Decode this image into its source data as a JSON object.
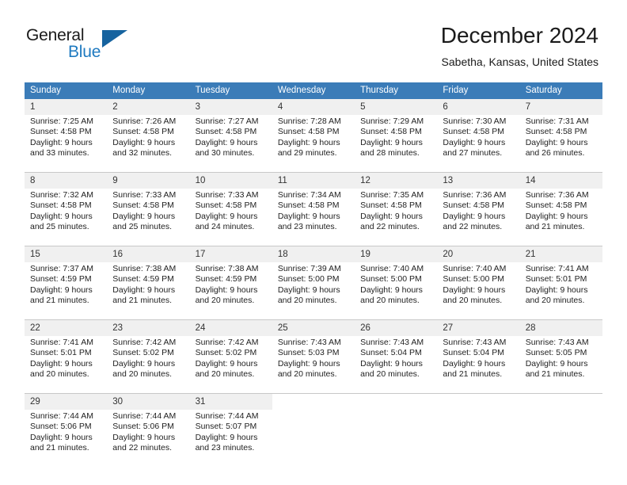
{
  "brand": {
    "name_top": "General",
    "name_bottom": "Blue",
    "triangle_color": "#16639f",
    "blue_color": "#1f7ac0"
  },
  "header": {
    "title": "December 2024",
    "subtitle": "Sabetha, Kansas, United States"
  },
  "theme": {
    "header_bg": "#3b7cb8",
    "daynum_bg": "#f0f0f0",
    "grid_line": "#c8c8c8"
  },
  "weekdays": [
    "Sunday",
    "Monday",
    "Tuesday",
    "Wednesday",
    "Thursday",
    "Friday",
    "Saturday"
  ],
  "weeks": [
    {
      "days": [
        {
          "num": "1",
          "sunrise": "Sunrise: 7:25 AM",
          "sunset": "Sunset: 4:58 PM",
          "daylight1": "Daylight: 9 hours",
          "daylight2": "and 33 minutes."
        },
        {
          "num": "2",
          "sunrise": "Sunrise: 7:26 AM",
          "sunset": "Sunset: 4:58 PM",
          "daylight1": "Daylight: 9 hours",
          "daylight2": "and 32 minutes."
        },
        {
          "num": "3",
          "sunrise": "Sunrise: 7:27 AM",
          "sunset": "Sunset: 4:58 PM",
          "daylight1": "Daylight: 9 hours",
          "daylight2": "and 30 minutes."
        },
        {
          "num": "4",
          "sunrise": "Sunrise: 7:28 AM",
          "sunset": "Sunset: 4:58 PM",
          "daylight1": "Daylight: 9 hours",
          "daylight2": "and 29 minutes."
        },
        {
          "num": "5",
          "sunrise": "Sunrise: 7:29 AM",
          "sunset": "Sunset: 4:58 PM",
          "daylight1": "Daylight: 9 hours",
          "daylight2": "and 28 minutes."
        },
        {
          "num": "6",
          "sunrise": "Sunrise: 7:30 AM",
          "sunset": "Sunset: 4:58 PM",
          "daylight1": "Daylight: 9 hours",
          "daylight2": "and 27 minutes."
        },
        {
          "num": "7",
          "sunrise": "Sunrise: 7:31 AM",
          "sunset": "Sunset: 4:58 PM",
          "daylight1": "Daylight: 9 hours",
          "daylight2": "and 26 minutes."
        }
      ]
    },
    {
      "days": [
        {
          "num": "8",
          "sunrise": "Sunrise: 7:32 AM",
          "sunset": "Sunset: 4:58 PM",
          "daylight1": "Daylight: 9 hours",
          "daylight2": "and 25 minutes."
        },
        {
          "num": "9",
          "sunrise": "Sunrise: 7:33 AM",
          "sunset": "Sunset: 4:58 PM",
          "daylight1": "Daylight: 9 hours",
          "daylight2": "and 25 minutes."
        },
        {
          "num": "10",
          "sunrise": "Sunrise: 7:33 AM",
          "sunset": "Sunset: 4:58 PM",
          "daylight1": "Daylight: 9 hours",
          "daylight2": "and 24 minutes."
        },
        {
          "num": "11",
          "sunrise": "Sunrise: 7:34 AM",
          "sunset": "Sunset: 4:58 PM",
          "daylight1": "Daylight: 9 hours",
          "daylight2": "and 23 minutes."
        },
        {
          "num": "12",
          "sunrise": "Sunrise: 7:35 AM",
          "sunset": "Sunset: 4:58 PM",
          "daylight1": "Daylight: 9 hours",
          "daylight2": "and 22 minutes."
        },
        {
          "num": "13",
          "sunrise": "Sunrise: 7:36 AM",
          "sunset": "Sunset: 4:58 PM",
          "daylight1": "Daylight: 9 hours",
          "daylight2": "and 22 minutes."
        },
        {
          "num": "14",
          "sunrise": "Sunrise: 7:36 AM",
          "sunset": "Sunset: 4:58 PM",
          "daylight1": "Daylight: 9 hours",
          "daylight2": "and 21 minutes."
        }
      ]
    },
    {
      "days": [
        {
          "num": "15",
          "sunrise": "Sunrise: 7:37 AM",
          "sunset": "Sunset: 4:59 PM",
          "daylight1": "Daylight: 9 hours",
          "daylight2": "and 21 minutes."
        },
        {
          "num": "16",
          "sunrise": "Sunrise: 7:38 AM",
          "sunset": "Sunset: 4:59 PM",
          "daylight1": "Daylight: 9 hours",
          "daylight2": "and 21 minutes."
        },
        {
          "num": "17",
          "sunrise": "Sunrise: 7:38 AM",
          "sunset": "Sunset: 4:59 PM",
          "daylight1": "Daylight: 9 hours",
          "daylight2": "and 20 minutes."
        },
        {
          "num": "18",
          "sunrise": "Sunrise: 7:39 AM",
          "sunset": "Sunset: 5:00 PM",
          "daylight1": "Daylight: 9 hours",
          "daylight2": "and 20 minutes."
        },
        {
          "num": "19",
          "sunrise": "Sunrise: 7:40 AM",
          "sunset": "Sunset: 5:00 PM",
          "daylight1": "Daylight: 9 hours",
          "daylight2": "and 20 minutes."
        },
        {
          "num": "20",
          "sunrise": "Sunrise: 7:40 AM",
          "sunset": "Sunset: 5:00 PM",
          "daylight1": "Daylight: 9 hours",
          "daylight2": "and 20 minutes."
        },
        {
          "num": "21",
          "sunrise": "Sunrise: 7:41 AM",
          "sunset": "Sunset: 5:01 PM",
          "daylight1": "Daylight: 9 hours",
          "daylight2": "and 20 minutes."
        }
      ]
    },
    {
      "days": [
        {
          "num": "22",
          "sunrise": "Sunrise: 7:41 AM",
          "sunset": "Sunset: 5:01 PM",
          "daylight1": "Daylight: 9 hours",
          "daylight2": "and 20 minutes."
        },
        {
          "num": "23",
          "sunrise": "Sunrise: 7:42 AM",
          "sunset": "Sunset: 5:02 PM",
          "daylight1": "Daylight: 9 hours",
          "daylight2": "and 20 minutes."
        },
        {
          "num": "24",
          "sunrise": "Sunrise: 7:42 AM",
          "sunset": "Sunset: 5:02 PM",
          "daylight1": "Daylight: 9 hours",
          "daylight2": "and 20 minutes."
        },
        {
          "num": "25",
          "sunrise": "Sunrise: 7:43 AM",
          "sunset": "Sunset: 5:03 PM",
          "daylight1": "Daylight: 9 hours",
          "daylight2": "and 20 minutes."
        },
        {
          "num": "26",
          "sunrise": "Sunrise: 7:43 AM",
          "sunset": "Sunset: 5:04 PM",
          "daylight1": "Daylight: 9 hours",
          "daylight2": "and 20 minutes."
        },
        {
          "num": "27",
          "sunrise": "Sunrise: 7:43 AM",
          "sunset": "Sunset: 5:04 PM",
          "daylight1": "Daylight: 9 hours",
          "daylight2": "and 21 minutes."
        },
        {
          "num": "28",
          "sunrise": "Sunrise: 7:43 AM",
          "sunset": "Sunset: 5:05 PM",
          "daylight1": "Daylight: 9 hours",
          "daylight2": "and 21 minutes."
        }
      ]
    },
    {
      "days": [
        {
          "num": "29",
          "sunrise": "Sunrise: 7:44 AM",
          "sunset": "Sunset: 5:06 PM",
          "daylight1": "Daylight: 9 hours",
          "daylight2": "and 21 minutes."
        },
        {
          "num": "30",
          "sunrise": "Sunrise: 7:44 AM",
          "sunset": "Sunset: 5:06 PM",
          "daylight1": "Daylight: 9 hours",
          "daylight2": "and 22 minutes."
        },
        {
          "num": "31",
          "sunrise": "Sunrise: 7:44 AM",
          "sunset": "Sunset: 5:07 PM",
          "daylight1": "Daylight: 9 hours",
          "daylight2": "and 23 minutes."
        },
        {
          "num": "",
          "sunrise": "",
          "sunset": "",
          "daylight1": "",
          "daylight2": ""
        },
        {
          "num": "",
          "sunrise": "",
          "sunset": "",
          "daylight1": "",
          "daylight2": ""
        },
        {
          "num": "",
          "sunrise": "",
          "sunset": "",
          "daylight1": "",
          "daylight2": ""
        },
        {
          "num": "",
          "sunrise": "",
          "sunset": "",
          "daylight1": "",
          "daylight2": ""
        }
      ]
    }
  ]
}
